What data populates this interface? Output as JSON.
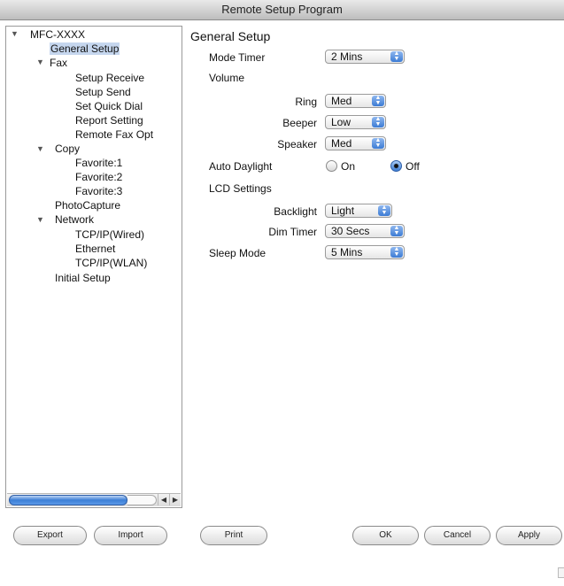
{
  "window": {
    "title": "Remote Setup Program"
  },
  "tree": {
    "root": "MFC-XXXX",
    "items": [
      "General Setup",
      "Fax",
      "Setup Receive",
      "Setup Send",
      "Set Quick Dial",
      "Report Setting",
      "Remote Fax Opt",
      "Copy",
      "Favorite:1",
      "Favorite:2",
      "Favorite:3",
      "PhotoCapture",
      "Network",
      "TCP/IP(Wired)",
      "Ethernet",
      "TCP/IP(WLAN)",
      "Initial Setup"
    ],
    "selected": "General Setup"
  },
  "general": {
    "title": "General Setup",
    "mode_timer": {
      "label": "Mode Timer",
      "value": "2 Mins"
    },
    "volume": {
      "label": "Volume",
      "ring": {
        "label": "Ring",
        "value": "Med"
      },
      "beeper": {
        "label": "Beeper",
        "value": "Low"
      },
      "speaker": {
        "label": "Speaker",
        "value": "Med"
      }
    },
    "auto_daylight": {
      "label": "Auto Daylight",
      "on": "On",
      "off": "Off",
      "selected": "Off"
    },
    "lcd": {
      "label": "LCD Settings",
      "backlight": {
        "label": "Backlight",
        "value": "Light"
      },
      "dim_timer": {
        "label": "Dim Timer",
        "value": "30 Secs"
      }
    },
    "sleep_mode": {
      "label": "Sleep Mode",
      "value": "5 Mins"
    }
  },
  "buttons": {
    "export": "Export",
    "import": "Import",
    "print": "Print",
    "ok": "OK",
    "cancel": "Cancel",
    "apply": "Apply"
  },
  "colors": {
    "selection": "#c5d6ee",
    "accent": "#3b7bd4"
  }
}
